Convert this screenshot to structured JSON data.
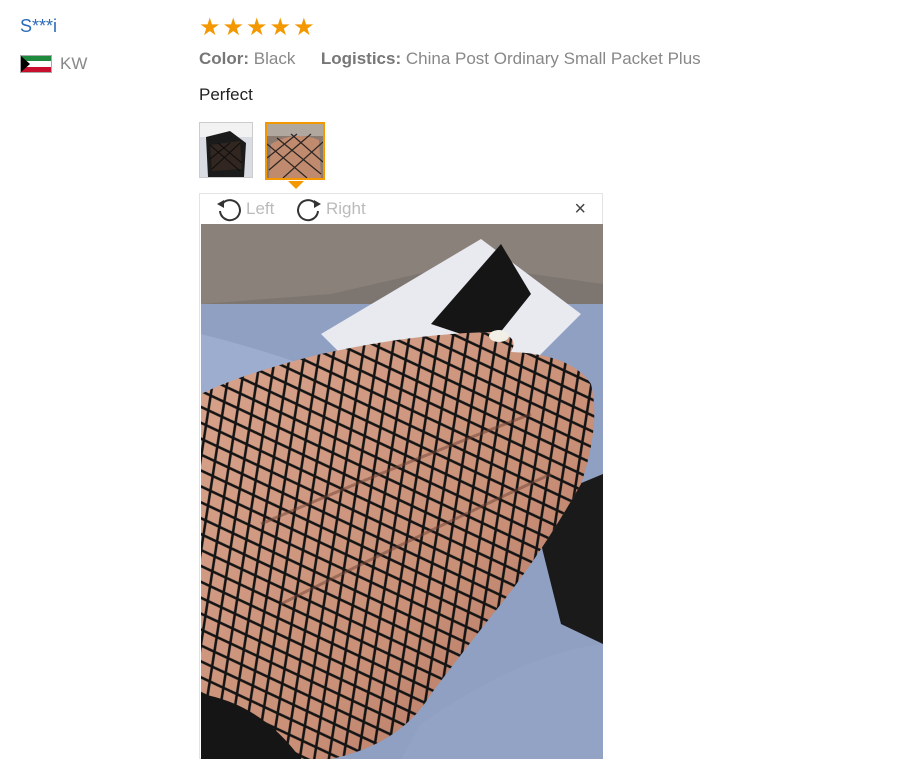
{
  "reviewer": {
    "name": "S***i",
    "country_code": "KW"
  },
  "rating": {
    "stars": 5,
    "max": 5,
    "color": "#f39800"
  },
  "attributes": [
    {
      "key": "Color:",
      "value": "Black"
    },
    {
      "key": "Logistics:",
      "value": "China Post Ordinary Small Packet Plus"
    }
  ],
  "review_text": "Perfect",
  "images": {
    "thumbnails": [
      "thumbnail-1",
      "thumbnail-2"
    ],
    "selected_index": 1
  },
  "viewer": {
    "rotate_left_label": "Left",
    "rotate_right_label": "Right",
    "close_glyph": "×"
  },
  "colors": {
    "accent": "#f39800",
    "username": "#2a6bb8"
  }
}
